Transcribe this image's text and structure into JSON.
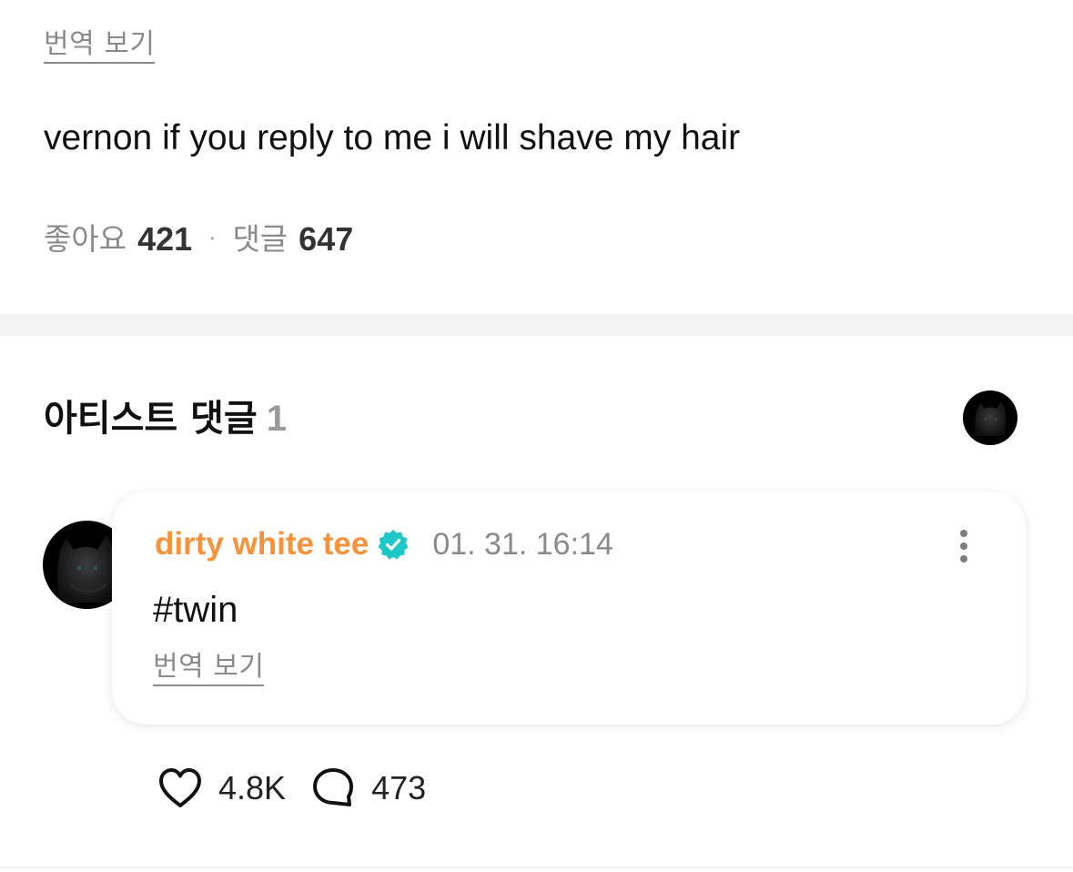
{
  "post": {
    "translate_label": "번역 보기",
    "body": "vernon if you reply to me i will shave my hair",
    "likes_label": "좋아요",
    "likes_count": "421",
    "separator_dot": "·",
    "comments_label": "댓글",
    "comments_count": "647"
  },
  "artist_comments": {
    "title": "아티스트 댓글",
    "count": "1",
    "items": [
      {
        "author": "dirty white tee",
        "verified": true,
        "timestamp": "01. 31. 16:14",
        "text": "#twin",
        "translate_label": "번역 보기",
        "like_count": "4.8K",
        "reply_count": "473"
      }
    ]
  },
  "colors": {
    "author": "#f5923a",
    "verified_badge": "#1ec8c8",
    "muted_text": "#8a8a8a",
    "separator": "#f4f4f5"
  },
  "icons": {
    "verified": "verified-badge-icon",
    "more": "more-vertical-icon",
    "like": "heart-icon",
    "reply": "comment-bubble-icon",
    "avatar": "cat-avatar-image"
  }
}
